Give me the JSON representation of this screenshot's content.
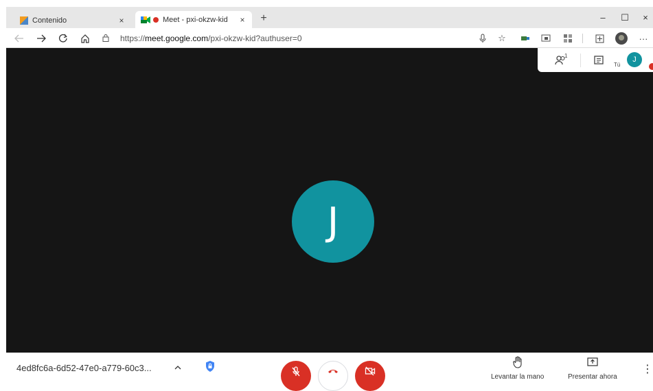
{
  "browser": {
    "tabs": [
      {
        "label": "Contenido",
        "close": "×"
      },
      {
        "label": "Meet - pxi-okzw-kid",
        "close": "×"
      }
    ],
    "new_tab": "+",
    "window_controls": [
      "–",
      "☐",
      "×"
    ],
    "address": {
      "prefix": "https://",
      "host": "meet.google.com",
      "path": "/pxi-okzw-kid?authuser=0"
    },
    "more": "···"
  },
  "meeting": {
    "avatar_letter": "J",
    "participants_count": "1",
    "you_label": "Tú",
    "self_avatar_letter": "J",
    "meeting_code": "4ed8fc6a-6d52-47e0-a779-60c3...",
    "actions": [
      {
        "label": "Levantar la mano"
      },
      {
        "label": "Presentar ahora"
      }
    ],
    "more": "⋮"
  },
  "colors": {
    "stage_bg": "#151515",
    "avatar": "#11939f",
    "danger": "#d93025",
    "tab_bar": "#e7e7e7"
  }
}
